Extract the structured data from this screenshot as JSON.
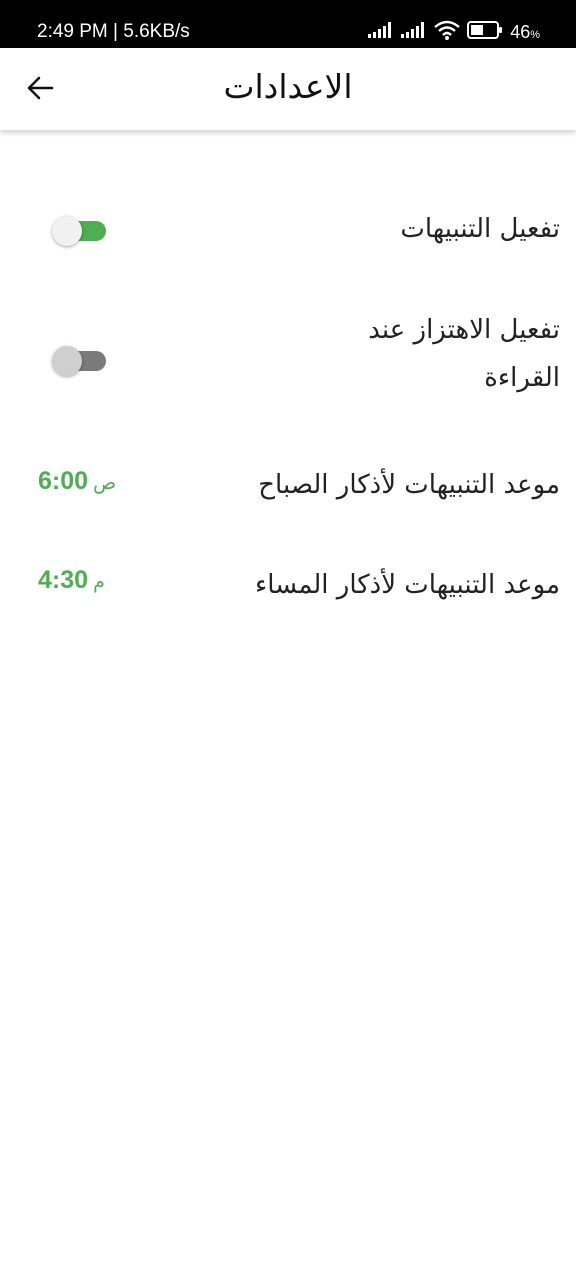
{
  "status_bar": {
    "time": "2:49 PM",
    "speed": "5.6KB/s",
    "battery": "46",
    "battery_unit": "%",
    "icons": [
      "signal-icon",
      "signal-icon",
      "wifi-icon",
      "battery-icon"
    ]
  },
  "app_bar": {
    "title": "الاعدادات",
    "back_icon": "arrow-back-icon"
  },
  "settings": {
    "notifications": {
      "label": "تفعيل التنبيهات",
      "enabled": true
    },
    "vibration": {
      "label": "تفعيل الاهتزاز عند القراءة",
      "enabled": false
    },
    "morning": {
      "label": "موعد التنبيهات لأذكار الصباح",
      "time": "6:00",
      "period": "ص"
    },
    "evening": {
      "label": "موعد التنبيهات لأذكار المساء",
      "time": "4:30",
      "period": "م"
    }
  },
  "colors": {
    "accent": "#4caf50",
    "switch_off_track": "#7a7a7a",
    "switch_off_thumb": "#cfcfcf",
    "switch_on_thumb": "#f1f1f1",
    "status_bar": "#000000"
  }
}
